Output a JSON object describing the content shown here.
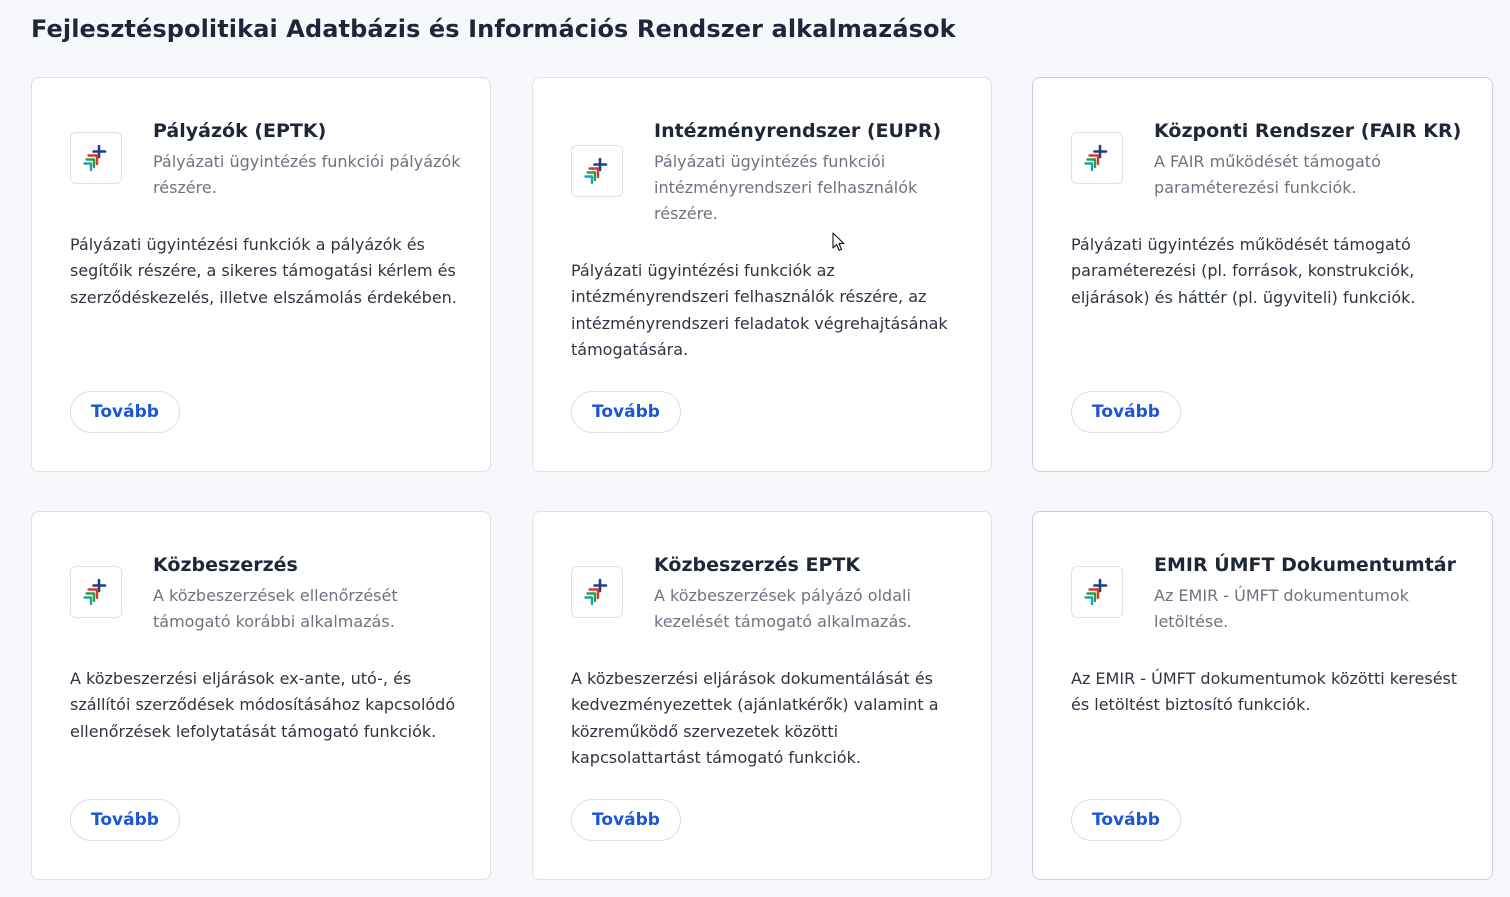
{
  "page": {
    "title": "Fejlesztéspolitikai Adatbázis és Információs Rendszer alkalmazások"
  },
  "cards": [
    {
      "logo_icon": "fair-logo-icon",
      "title": "Pályázók (EPTK)",
      "subtitle": "Pályázati ügyintézés funkciói pályázók részére.",
      "description": "Pályázati ügyintézési funkciók a pályázók és segítőik részére, a sikeres támogatási kérlem és szerződéskezelés, illetve elszámolás érdekében.",
      "button_label": "Tovább"
    },
    {
      "logo_icon": "fair-logo-icon",
      "title": "Intézményrendszer (EUPR)",
      "subtitle": "Pályázati ügyintézés funkciói intézményrendszeri felhasználók részére.",
      "description": "Pályázati ügyintézési funkciók az intézményrendszeri felhasználók részére, az intézményrendszeri feladatok végrehajtásának támogatására.",
      "button_label": "Tovább"
    },
    {
      "logo_icon": "fair-logo-icon",
      "title": "Központi Rendszer (FAIR KR)",
      "subtitle": "A FAIR működését támogató paraméterezési funkciók.",
      "description": "Pályázati ügyintézés működését támogató paraméterezési (pl. források, konstrukciók, eljárások) és háttér (pl. ügyviteli) funkciók.",
      "button_label": "Tovább"
    },
    {
      "logo_icon": "fair-logo-icon",
      "title": "Közbeszerzés",
      "subtitle": "A közbeszerzések ellenőrzését támogató korábbi alkalmazás.",
      "description": "A közbeszerzési eljárások ex-ante, utó-, és szállítói szerződések módosításához kapcsolódó ellenőrzések lefolytatását támogató funkciók.",
      "button_label": "Tovább"
    },
    {
      "logo_icon": "fair-logo-icon",
      "title": "Közbeszerzés EPTK",
      "subtitle": "A közbeszerzések pályázó oldali kezelését támogató alkalmazás.",
      "description": "A közbeszerzési eljárások dokumentálását és kedvezményezettek (ajánlatkérők) valamint a közreműködő szervezetek közötti kapcsolattartást támogató funkciók.",
      "button_label": "Tovább"
    },
    {
      "logo_icon": "fair-logo-icon",
      "title": "EMIR ÚMFT Dokumentumtár",
      "subtitle": "Az EMIR - ÚMFT dokumentumok letöltése.",
      "description": "Az EMIR - ÚMFT dokumentumok közötti keresést és letöltést biztosító funkciók.",
      "button_label": "Tovább"
    }
  ],
  "colors": {
    "background": "#f6f8fc",
    "card": "#ffffff",
    "button_text": "#1a56d6",
    "logo_navy": "#1f3f8a",
    "logo_red": "#e1352b",
    "logo_green": "#2a9d4a",
    "logo_teal": "#1fa0b2"
  }
}
